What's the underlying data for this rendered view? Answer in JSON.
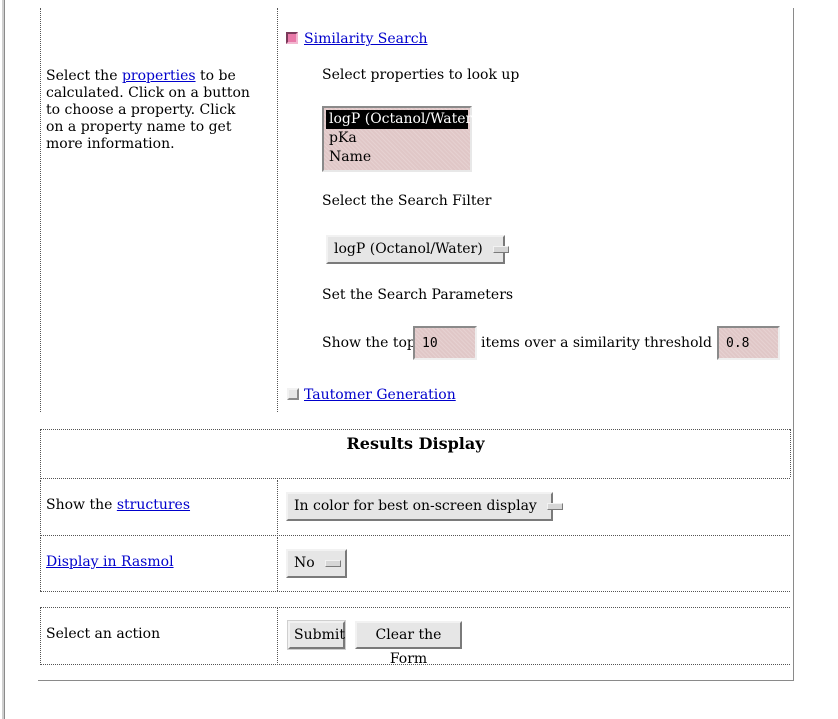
{
  "intro": {
    "text_before": "Select the ",
    "link": "properties",
    "text_after": " to be calculated. Click on a button to choose a property. Click on a property name to get more information."
  },
  "similarity": {
    "title": "Similarity Search",
    "checked": true,
    "lookup_label": "Select properties to look up",
    "property_options": [
      "logP (Octanol/Water)",
      "pKa",
      "Name"
    ],
    "selected_property": "logP (Octanol/Water)",
    "filter_label": "Select the Search Filter",
    "filter_value": "logP (Octanol/Water)",
    "params_label": "Set the Search Parameters",
    "show_top_label": "Show the top",
    "top_value": "10",
    "threshold_label": "items over a similarity threshold of",
    "threshold_value": "0.8"
  },
  "tautomer": {
    "title": "Tautomer Generation",
    "checked": false
  },
  "results": {
    "heading": "Results Display",
    "structures_prefix": "Show the ",
    "structures_link": "structures",
    "structures_value": "In color for best on-screen display",
    "rasmol_link": "Display in Rasmol",
    "rasmol_value": "No"
  },
  "action": {
    "label": "Select an action",
    "submit": "Submit",
    "clear": "Clear the Form"
  },
  "colors": {
    "link": "#0000cc",
    "checked_box": "#e879a8",
    "field_bg": "#e0c7c7"
  }
}
